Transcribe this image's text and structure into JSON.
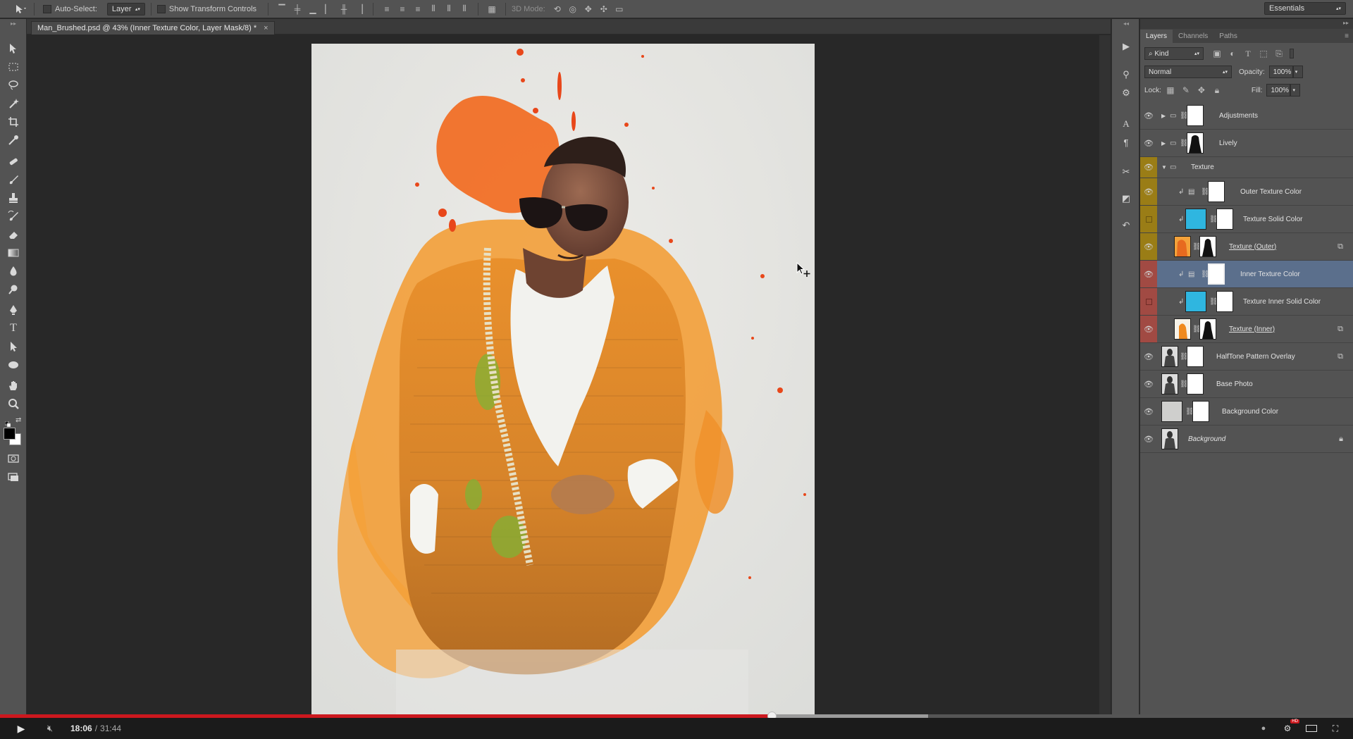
{
  "options_bar": {
    "tool_icon": "move-tool-icon",
    "auto_select_label": "Auto-Select:",
    "auto_select_value": "Layer",
    "show_transform_label": "Show Transform Controls",
    "mode_3d_label": "3D Mode:",
    "workspace_value": "Essentials"
  },
  "document": {
    "tab_title": "Man_Brushed.psd @ 43% (Inner Texture Color, Layer Mask/8) *",
    "close_glyph": "×"
  },
  "tools": [
    "move-tool",
    "marquee-tool",
    "lasso-tool",
    "magic-wand-tool",
    "crop-tool",
    "eyedropper-tool",
    "healing-brush-tool",
    "brush-tool",
    "clone-stamp-tool",
    "history-brush-tool",
    "eraser-tool",
    "gradient-tool",
    "blur-tool",
    "dodge-tool",
    "pen-tool",
    "type-tool",
    "path-selection-tool",
    "ellipse-tool",
    "hand-tool",
    "zoom-tool"
  ],
  "panel": {
    "tabs": [
      "Layers",
      "Channels",
      "Paths"
    ],
    "active_tab": "Layers",
    "kind_filter": "Kind",
    "blend_mode": "Normal",
    "opacity_label": "Opacity:",
    "opacity_value": "100%",
    "lock_label": "Lock:",
    "fill_label": "Fill:",
    "fill_value": "100%"
  },
  "layers": [
    {
      "name": "Adjustments",
      "type": "group-collapsed",
      "visible": true,
      "color": "none"
    },
    {
      "name": "Lively",
      "type": "group-collapsed",
      "visible": true,
      "color": "none"
    },
    {
      "name": "Texture",
      "type": "group-expanded",
      "visible": true,
      "color": "yellow"
    },
    {
      "name": "Outer Texture Color",
      "type": "adjustment-clipped",
      "visible": true,
      "color": "yellow"
    },
    {
      "name": "Texture Solid Color",
      "type": "fill-clipped",
      "visible": false,
      "color": "yellow"
    },
    {
      "name": "Texture (Outer)",
      "type": "smart-masked",
      "visible": true,
      "color": "yellow"
    },
    {
      "name": "Inner Texture Color",
      "type": "adjustment-clipped",
      "visible": true,
      "color": "red",
      "selected": true
    },
    {
      "name": "Texture Inner Solid Color",
      "type": "fill-clipped",
      "visible": false,
      "color": "red"
    },
    {
      "name": "Texture (Inner)",
      "type": "smart-masked",
      "visible": true,
      "color": "red"
    },
    {
      "name": "HalfTone Pattern Overlay",
      "type": "photo-masked-smart",
      "visible": true,
      "color": "none"
    },
    {
      "name": "Base Photo",
      "type": "photo-masked",
      "visible": true,
      "color": "none"
    },
    {
      "name": "Background Color",
      "type": "fill-masked",
      "visible": true,
      "color": "none"
    },
    {
      "name": "Background",
      "type": "background-locked",
      "visible": true,
      "color": "none"
    }
  ],
  "video": {
    "time_current": "18:06",
    "time_total": "31:44",
    "progress_fraction": 0.5703,
    "buffered_fraction": 0.686
  },
  "colors": {
    "accent_red": "#cc181e",
    "layer_selected": "#5b6f8c",
    "label_yellow": "#9a7d16",
    "label_red": "#a14a43",
    "swatch_cyan": "#2fb6e0",
    "paint_orange": "#f08a1f"
  }
}
